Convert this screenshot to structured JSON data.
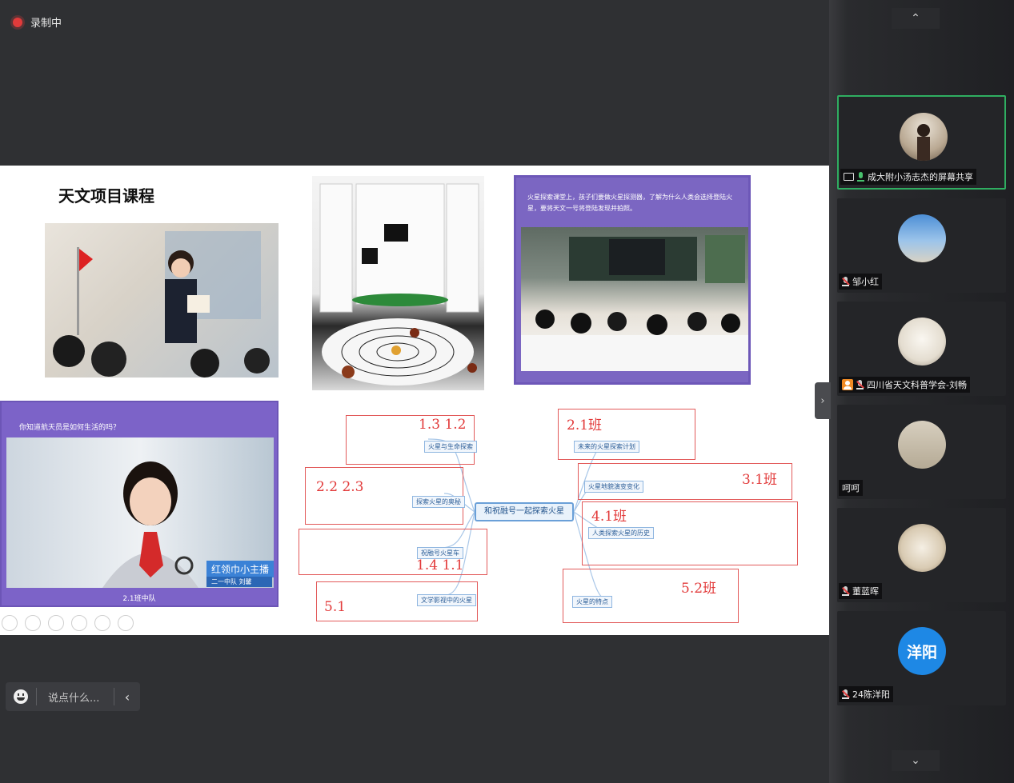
{
  "recording": {
    "label": "录制中"
  },
  "slide": {
    "title": "天文项目课程",
    "class_caption": "火星探索课堂上，孩子们要做火星探测器，了解为什么人类会选择登陆火星，要将天文一号将登陆发现并拍照。",
    "girl_question": "你知道航天员是如何生活的吗？",
    "girl_badge": "红领巾小主播",
    "girl_badge_sub": "二一中队  刘馨",
    "girl_footer": "2.1班中队"
  },
  "mindmap": {
    "center": "和祝融号一起探索火星",
    "branches": [
      {
        "tag": "1.3 1.2",
        "node": "火星与生命探索"
      },
      {
        "tag": "2.2 2.3",
        "node": "探索火星的奥秘"
      },
      {
        "tag": "1.4 1.1",
        "node": "祝融号火星车"
      },
      {
        "tag": "5.1",
        "node": "文学影视中的火星"
      },
      {
        "tag": "2.1班",
        "node": "未来的火星探索计划"
      },
      {
        "tag": "3.1班",
        "node": "火星地貌演变变化"
      },
      {
        "tag": "4.1班",
        "node": "人类探索火星的历史"
      },
      {
        "tag": "5.2班",
        "node": "火星的特点"
      }
    ]
  },
  "chat": {
    "placeholder": "说点什么..."
  },
  "participants": [
    {
      "name": "成大附小汤志杰的屏幕共享",
      "active": true
    },
    {
      "name": "邹小红",
      "active": false
    },
    {
      "name": "四川省天文科普学会-刘畅",
      "active": false
    },
    {
      "name": "呵呵",
      "active": false
    },
    {
      "name": "董蓝晖",
      "active": false
    },
    {
      "name": "24陈洋阳",
      "active": false,
      "avatar_text": "洋阳"
    }
  ],
  "colors": {
    "accent": "#2fae61",
    "record": "#e23b3b",
    "slide_purple": "#7b66c2",
    "mindmap_red": "#e25a5a"
  }
}
